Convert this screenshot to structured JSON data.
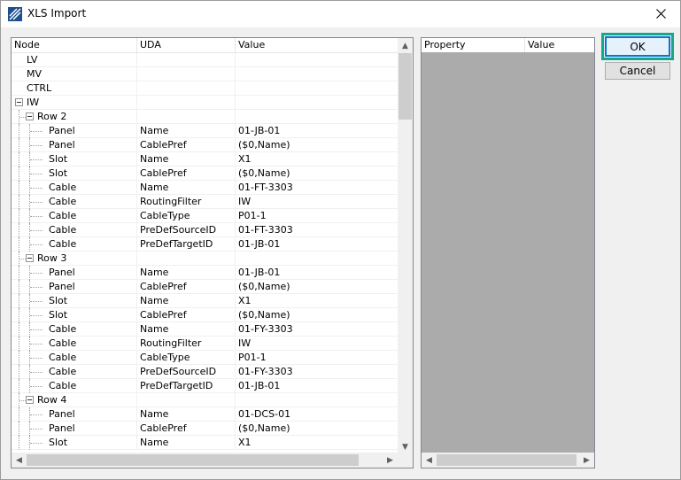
{
  "window": {
    "title": "XLS Import",
    "icon": "xls-import-app-icon",
    "close_icon": "close-icon"
  },
  "tree": {
    "columns": [
      "Node",
      "UDA",
      "Value"
    ],
    "rows": [
      {
        "node": "LV",
        "uda": "",
        "value": "",
        "level": 0,
        "expander": false
      },
      {
        "node": "MV",
        "uda": "",
        "value": "",
        "level": 0,
        "expander": false
      },
      {
        "node": "CTRL",
        "uda": "",
        "value": "",
        "level": 0,
        "expander": false
      },
      {
        "node": "IW",
        "uda": "",
        "value": "",
        "level": 0,
        "expander": true
      },
      {
        "node": "Row 2",
        "uda": "",
        "value": "",
        "level": 1,
        "expander": true
      },
      {
        "node": "Panel",
        "uda": "Name",
        "value": "01-JB-01",
        "level": 2,
        "expander": false
      },
      {
        "node": "Panel",
        "uda": "CablePref",
        "value": "($0,Name)",
        "level": 2,
        "expander": false
      },
      {
        "node": "Slot",
        "uda": "Name",
        "value": "X1",
        "level": 2,
        "expander": false
      },
      {
        "node": "Slot",
        "uda": "CablePref",
        "value": "($0,Name)",
        "level": 2,
        "expander": false
      },
      {
        "node": "Cable",
        "uda": "Name",
        "value": "01-FT-3303",
        "level": 2,
        "expander": false
      },
      {
        "node": "Cable",
        "uda": "RoutingFilter",
        "value": "IW",
        "level": 2,
        "expander": false
      },
      {
        "node": "Cable",
        "uda": "CableType",
        "value": "P01-1",
        "level": 2,
        "expander": false
      },
      {
        "node": "Cable",
        "uda": "PreDefSourceID",
        "value": "01-FT-3303",
        "level": 2,
        "expander": false
      },
      {
        "node": "Cable",
        "uda": "PreDefTargetID",
        "value": "01-JB-01",
        "level": 2,
        "expander": false
      },
      {
        "node": "Row 3",
        "uda": "",
        "value": "",
        "level": 1,
        "expander": true
      },
      {
        "node": "Panel",
        "uda": "Name",
        "value": "01-JB-01",
        "level": 2,
        "expander": false
      },
      {
        "node": "Panel",
        "uda": "CablePref",
        "value": "($0,Name)",
        "level": 2,
        "expander": false
      },
      {
        "node": "Slot",
        "uda": "Name",
        "value": "X1",
        "level": 2,
        "expander": false
      },
      {
        "node": "Slot",
        "uda": "CablePref",
        "value": "($0,Name)",
        "level": 2,
        "expander": false
      },
      {
        "node": "Cable",
        "uda": "Name",
        "value": "01-FY-3303",
        "level": 2,
        "expander": false
      },
      {
        "node": "Cable",
        "uda": "RoutingFilter",
        "value": "IW",
        "level": 2,
        "expander": false
      },
      {
        "node": "Cable",
        "uda": "CableType",
        "value": "P01-1",
        "level": 2,
        "expander": false
      },
      {
        "node": "Cable",
        "uda": "PreDefSourceID",
        "value": "01-FY-3303",
        "level": 2,
        "expander": false
      },
      {
        "node": "Cable",
        "uda": "PreDefTargetID",
        "value": "01-JB-01",
        "level": 2,
        "expander": false
      },
      {
        "node": "Row 4",
        "uda": "",
        "value": "",
        "level": 1,
        "expander": true
      },
      {
        "node": "Panel",
        "uda": "Name",
        "value": "01-DCS-01",
        "level": 2,
        "expander": false
      },
      {
        "node": "Panel",
        "uda": "CablePref",
        "value": "($0,Name)",
        "level": 2,
        "expander": false
      },
      {
        "node": "Slot",
        "uda": "Name",
        "value": "X1",
        "level": 2,
        "expander": false
      }
    ]
  },
  "properties": {
    "columns": [
      "Property",
      "Value"
    ]
  },
  "buttons": {
    "ok": "OK",
    "cancel": "Cancel"
  },
  "colors": {
    "focus_highlight": "#19a68a",
    "ok_border": "#0078d7",
    "panel_gray": "#ababab"
  }
}
